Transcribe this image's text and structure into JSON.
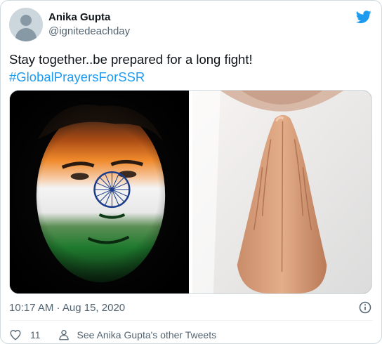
{
  "author": {
    "display_name": "Anika Gupta",
    "handle": "@ignitedeachday"
  },
  "tweet": {
    "text_line1": "Stay together..be prepared for a long fight!",
    "hashtag": "#GlobalPrayersForSSR"
  },
  "meta": {
    "timestamp": "10:17 AM · Aug 15, 2020"
  },
  "actions": {
    "like_count": "11",
    "profile_link": "See Anika Gupta's other Tweets"
  },
  "colors": {
    "accent": "#1d9bf0",
    "saffron": "#f08a2c",
    "flag_green": "#1f7a2e",
    "chakra_blue": "#1a3a8a"
  },
  "icons": {
    "logo": "twitter-bird-icon",
    "info": "info-icon",
    "like": "heart-icon",
    "profile": "person-icon"
  }
}
